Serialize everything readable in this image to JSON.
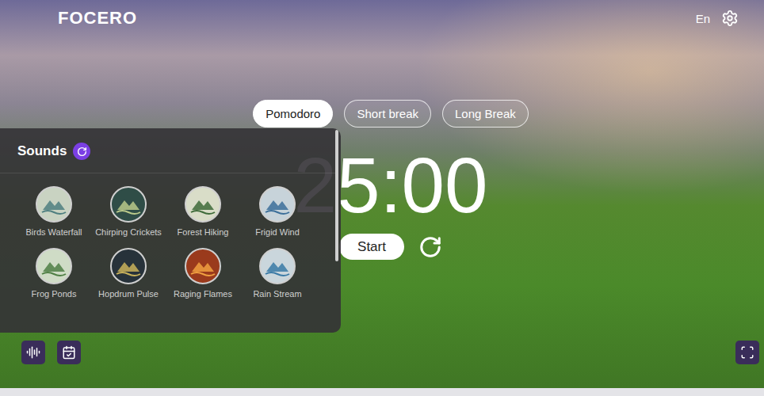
{
  "logo": "FOCERO",
  "language": "En",
  "tabs": [
    {
      "label": "Pomodoro",
      "selected": true
    },
    {
      "label": "Short break",
      "selected": false
    },
    {
      "label": "Long Break",
      "selected": false
    }
  ],
  "timer": "25:00",
  "start_button": "Start",
  "sounds": {
    "title": "Sounds",
    "items": [
      {
        "label": "Birds Waterfall",
        "selected": false
      },
      {
        "label": "Chirping Crickets",
        "selected": false
      },
      {
        "label": "Forest Hiking",
        "selected": false
      },
      {
        "label": "Frigid Wind",
        "selected": false
      },
      {
        "label": "Frog Ponds",
        "selected": false
      },
      {
        "label": "Hopdrum Pulse",
        "selected": false
      },
      {
        "label": "Raging Flames",
        "selected": false
      },
      {
        "label": "Rain Stream",
        "selected": false
      }
    ]
  }
}
